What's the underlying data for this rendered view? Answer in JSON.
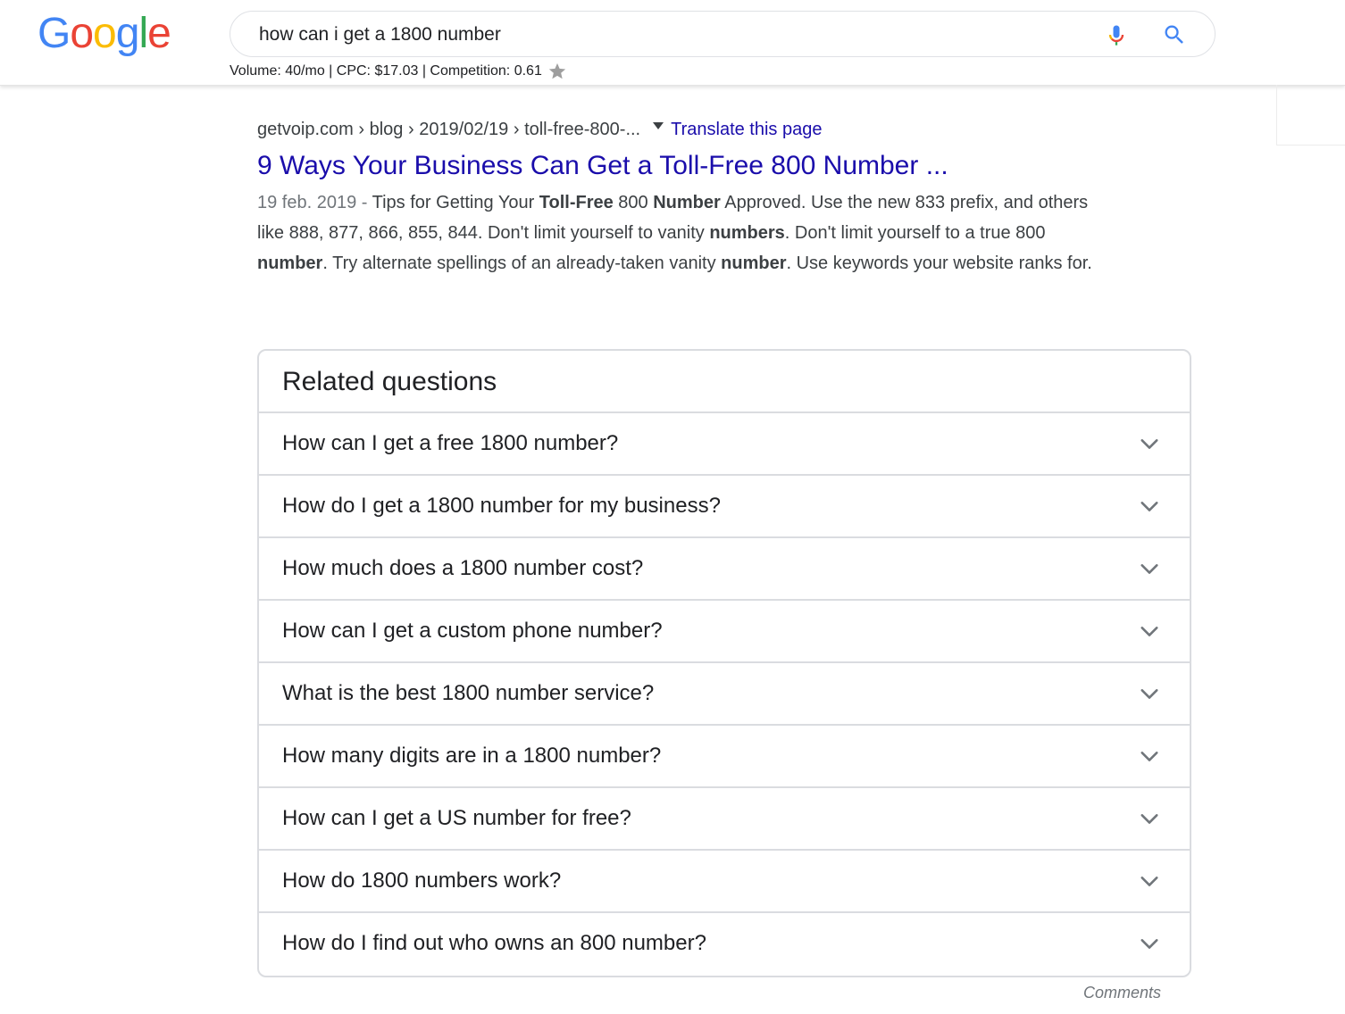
{
  "logo": {
    "letters": [
      "G",
      "o",
      "o",
      "g",
      "l",
      "e"
    ],
    "colors": [
      "#4285F4",
      "#EA4335",
      "#FBBC05",
      "#4285F4",
      "#34A853",
      "#EA4335"
    ]
  },
  "search": {
    "query": "how can i get a 1800 number"
  },
  "keyword_stats": {
    "text": "Volume: 40/mo | CPC: $17.03 | Competition: 0.61"
  },
  "result": {
    "breadcrumb": "getvoip.com › blog › 2019/02/19 › toll-free-800-...",
    "translate_label": "Translate this page",
    "title": "9 Ways Your Business Can Get a Toll-Free 800 Number ...",
    "date": "19 feb. 2019",
    "date_separator": " - ",
    "snippet_parts": [
      {
        "text": "Tips for Getting Your ",
        "bold": false
      },
      {
        "text": "Toll-Free",
        "bold": true
      },
      {
        "text": " 800 ",
        "bold": false
      },
      {
        "text": "Number",
        "bold": true
      },
      {
        "text": " Approved. Use the new 833 prefix, and others like 888, 877, 866, 855, 844. Don't limit yourself to vanity ",
        "bold": false
      },
      {
        "text": "numbers",
        "bold": true
      },
      {
        "text": ". Don't limit yourself to a true 800 ",
        "bold": false
      },
      {
        "text": "number",
        "bold": true
      },
      {
        "text": ". Try alternate spellings of an already-taken vanity ",
        "bold": false
      },
      {
        "text": "number",
        "bold": true
      },
      {
        "text": ". Use keywords your website ranks for.",
        "bold": false
      }
    ]
  },
  "related_questions": {
    "title": "Related questions",
    "items": [
      "How can I get a free 1800 number?",
      "How do I get a 1800 number for my business?",
      "How much does a 1800 number cost?",
      "How can I get a custom phone number?",
      "What is the best 1800 number service?",
      "How many digits are in a 1800 number?",
      "How can I get a US number for free?",
      "How do 1800 numbers work?",
      "How do I find out who owns an 800 number?"
    ]
  },
  "comments_label": "Comments",
  "colors": {
    "link": "#1a0dab",
    "text": "#202124",
    "snippet": "#3c4043",
    "muted": "#70757a",
    "border": "#dadce0"
  },
  "icons": {
    "mic": "mic-icon",
    "search": "search-icon",
    "star": "star-icon",
    "expand": "chevron-down-icon",
    "dropdown": "caret-down-icon"
  }
}
